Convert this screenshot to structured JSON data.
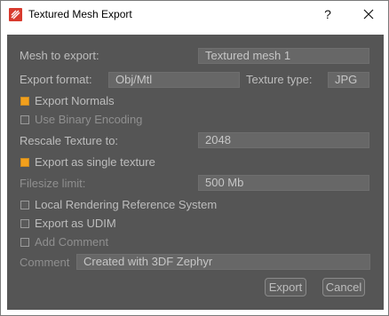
{
  "window": {
    "title": "Textured Mesh Export"
  },
  "titlebar": {
    "help_label": "?"
  },
  "mesh_to_export": {
    "label": "Mesh to export:",
    "value": "Textured mesh 1"
  },
  "export_format": {
    "label": "Export format:",
    "value": "Obj/Mtl"
  },
  "texture_type": {
    "label": "Texture type:",
    "value": "JPG"
  },
  "export_normals": {
    "label": "Export Normals",
    "checked": true
  },
  "binary_encoding": {
    "label": "Use Binary Encoding",
    "checked": false
  },
  "rescale_texture": {
    "label": "Rescale Texture to:",
    "value": "2048"
  },
  "single_texture": {
    "label": "Export as single texture",
    "checked": true
  },
  "filesize_limit": {
    "label": "Filesize limit:",
    "value": "500 Mb"
  },
  "local_reference": {
    "label": "Local Rendering Reference System",
    "checked": false
  },
  "export_udim": {
    "label": "Export as UDIM",
    "checked": false
  },
  "add_comment": {
    "label": "Add Comment",
    "checked": false
  },
  "comment": {
    "label": "Comment",
    "value": "Created with 3DF Zephyr"
  },
  "buttons": {
    "export": "Export",
    "cancel": "Cancel"
  },
  "colors": {
    "panel": "#555555",
    "field": "#676767",
    "text": "#bdbdbd",
    "accent": "#f2a01c"
  },
  "icons": {
    "app": "3df-zephyr-app-icon",
    "close": "close-icon"
  }
}
